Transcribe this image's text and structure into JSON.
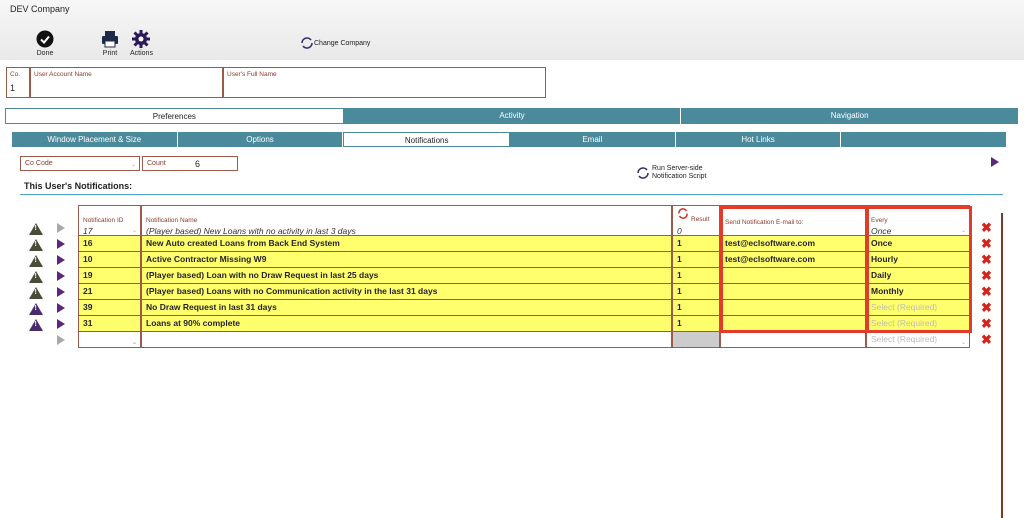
{
  "app": {
    "title": "DEV Company"
  },
  "toolbar": {
    "done": "Done",
    "print": "Print",
    "actions": "Actions",
    "change_company": "Change Company"
  },
  "user": {
    "co_label": "Co.",
    "co_value": "1",
    "account_label": "User Account Name",
    "account_value": "",
    "fullname_label": "User's Full Name",
    "fullname_value": ""
  },
  "main_tabs": [
    "Preferences",
    "Activity",
    "Navigation"
  ],
  "sub_tabs": [
    "Window Placement & Size",
    "Options",
    "Notifications",
    "Email",
    "Hot Links",
    ""
  ],
  "filter": {
    "co_code_label": "Co Code",
    "count_label": "Count",
    "count_value": "6"
  },
  "run_script": {
    "line1": "Run Server-side",
    "line2": "Notification Script"
  },
  "section_title": "This User's Notifications:",
  "columns": {
    "id": "Notification ID",
    "name": "Notification Name",
    "result": "Result",
    "email": "Send Notification E-mail to:",
    "every": "Every"
  },
  "header_row": {
    "id": "17",
    "name": "(Player based) New Loans with no activity in last 3 days",
    "result": "0",
    "email": "",
    "every": "Once"
  },
  "rows": [
    {
      "id": "16",
      "name": "New Auto created Loans from Back End System",
      "result": "1",
      "email": "test@eclsoftware.com",
      "every": "Once"
    },
    {
      "id": "10",
      "name": "Active Contractor Missing W9",
      "result": "1",
      "email": "test@eclsoftware.com",
      "every": "Hourly"
    },
    {
      "id": "19",
      "name": "(Player based) Loan with no Draw Request in last 25 days",
      "result": "1",
      "email": "",
      "every": "Daily"
    },
    {
      "id": "21",
      "name": "(Player based) Loans with no Communication activity in the last 31 days",
      "result": "1",
      "email": "",
      "every": "Monthly"
    },
    {
      "id": "39",
      "name": "No Draw Request in last 31 days",
      "result": "1",
      "email": "",
      "every": "Select (Required)"
    },
    {
      "id": "31",
      "name": "Loans at 90% complete",
      "result": "1",
      "email": "",
      "every": "Select (Required)"
    }
  ],
  "empty_row": {
    "every": "Select (Required)"
  },
  "colors": {
    "tab": "#4a8a9b",
    "highlight": "#ffff6e",
    "accent": "#5a2a7a",
    "delete": "#d8231b",
    "callout": "#e23b2a"
  }
}
